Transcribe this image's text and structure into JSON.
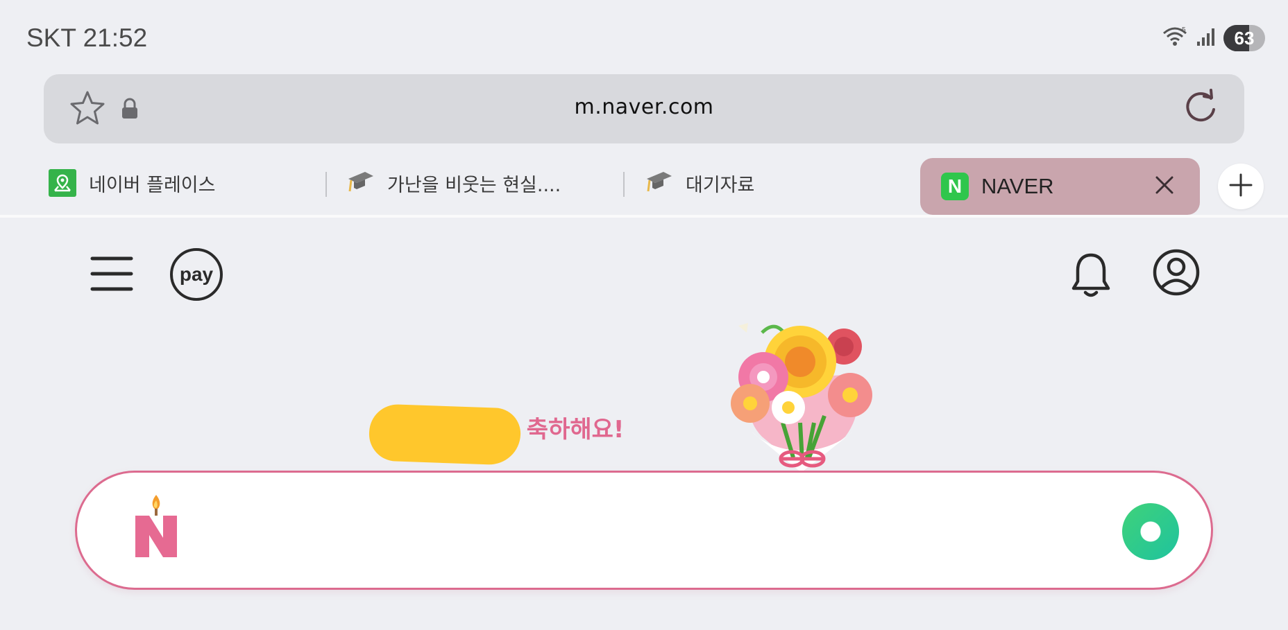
{
  "status_bar": {
    "carrier_time": "SKT 21:52",
    "battery": "63",
    "icons": [
      "wifi-icon",
      "signal-icon",
      "battery-icon"
    ]
  },
  "address_bar": {
    "url": "m.naver.com",
    "icons": [
      "star-icon",
      "lock-icon",
      "reload-icon"
    ]
  },
  "tabs": [
    {
      "title": "네이버 플레이스",
      "icon": "map-pin-icon"
    },
    {
      "title": "가난을 비웃는 현실....",
      "icon": "graduation-cap-icon"
    },
    {
      "title": "대기자료",
      "icon": "graduation-cap-icon"
    },
    {
      "title": "NAVER",
      "icon": "naver-n-icon",
      "active": true
    }
  ],
  "naver_header": {
    "pay_label": "pay",
    "icons": [
      "hamburger-menu-icon",
      "bell-icon",
      "user-profile-icon"
    ]
  },
  "doodle": {
    "message": "님 생일을 축하해요!"
  },
  "search": {
    "value": "",
    "logo_letter": "N"
  },
  "colors": {
    "accent_pink": "#dc6b8f",
    "naver_green": "#2fc64c",
    "active_tab": "#c9a5ad",
    "redaction": "#ffc72c"
  }
}
